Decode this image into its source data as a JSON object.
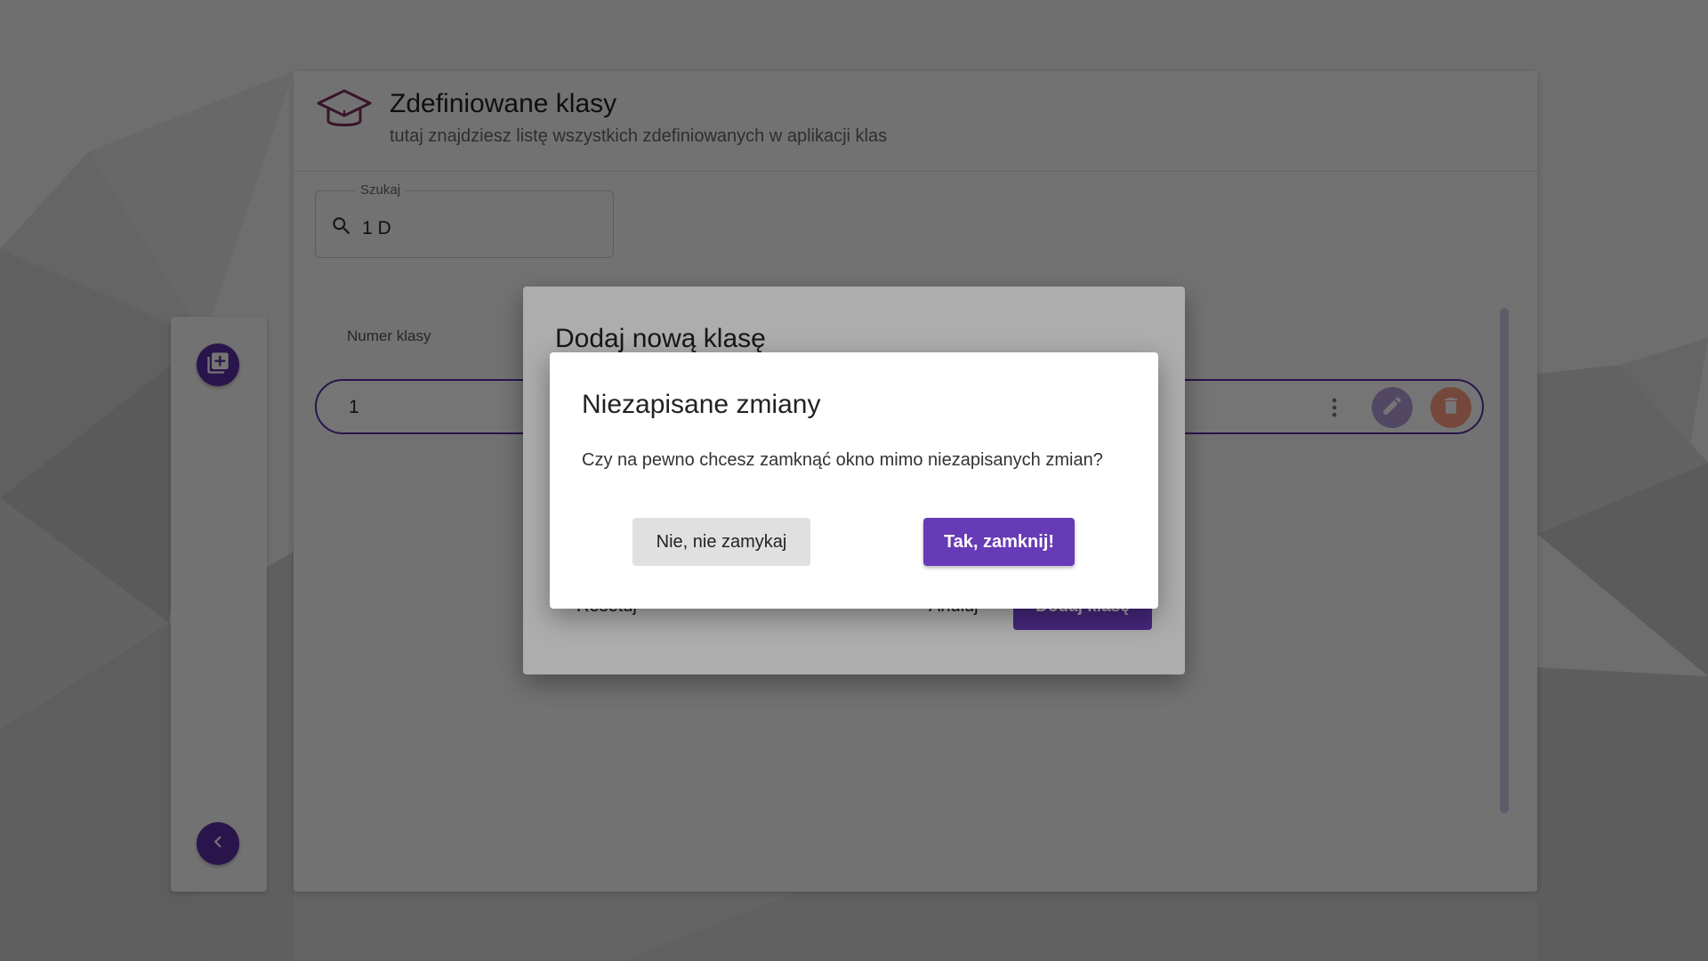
{
  "page": {
    "title": "Zdefiniowane klasy",
    "subtitle": "tutaj znajdziesz listę wszystkich zdefiniowanych w aplikacji klas",
    "header_icon": "graduation-cap-icon"
  },
  "search": {
    "label": "Szukaj",
    "value": "1 D"
  },
  "table": {
    "column_header": "Numer klasy",
    "rows": [
      {
        "class_number": "1"
      }
    ]
  },
  "sidebar": {
    "add_icon": "library-add-icon",
    "collapse_icon": "chevron-left-icon"
  },
  "add_dialog": {
    "title": "Dodaj nową klasę",
    "reset_label": "Resetuj",
    "cancel_label": "Anuluj",
    "submit_label": "Dodaj klasę"
  },
  "confirm_dialog": {
    "title": "Niezapisane zmiany",
    "message": "Czy na pewno chcesz zamknąć okno mimo niezapisanych zmian?",
    "cancel_label": "Nie, nie zamykaj",
    "confirm_label": "Tak, zamknij!"
  },
  "colors": {
    "accent": "#673ab7",
    "accent_dark": "#5b2ea6",
    "edit": "#b39ddb",
    "delete": "#ff9e80"
  }
}
